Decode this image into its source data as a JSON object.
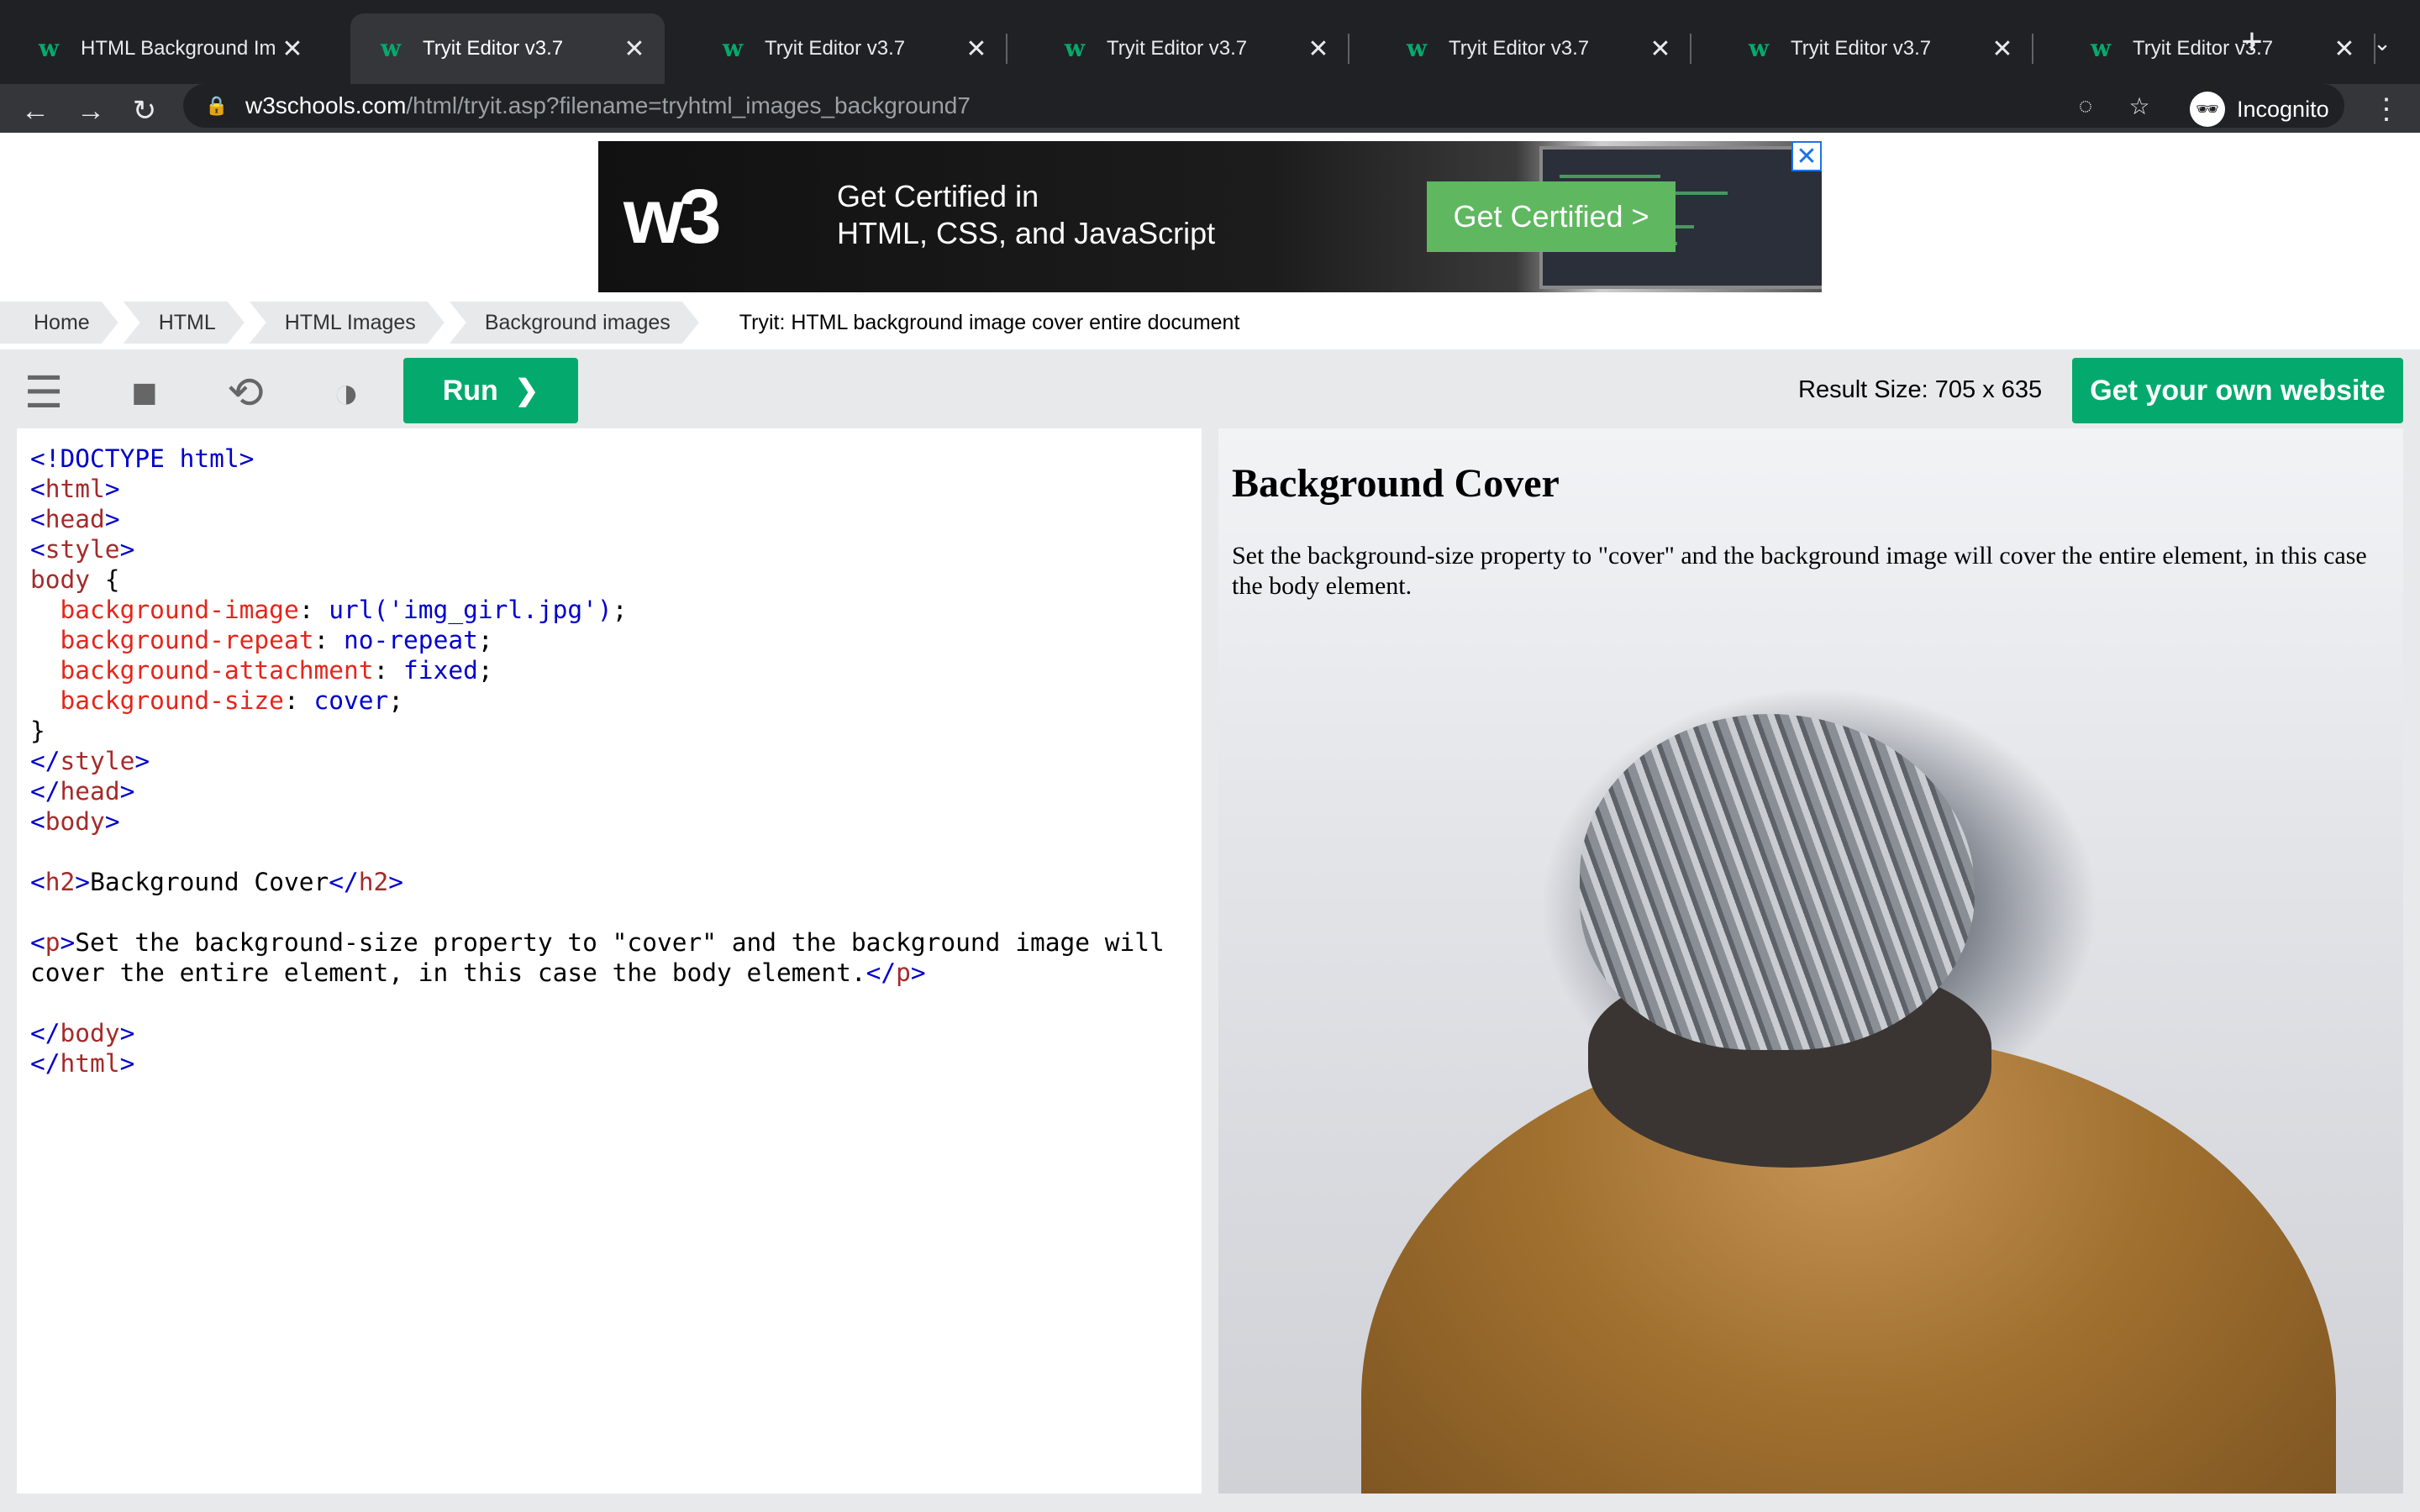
{
  "browser": {
    "tabs": [
      {
        "title": "HTML Background Im",
        "active": false
      },
      {
        "title": "Tryit Editor v3.7",
        "active": true
      },
      {
        "title": "Tryit Editor v3.7",
        "active": false
      },
      {
        "title": "Tryit Editor v3.7",
        "active": false
      },
      {
        "title": "Tryit Editor v3.7",
        "active": false
      },
      {
        "title": "Tryit Editor v3.7",
        "active": false
      },
      {
        "title": "Tryit Editor v3.7",
        "active": false
      }
    ],
    "favicon_glyph": "w",
    "close_glyph": "✕",
    "new_tab_glyph": "+",
    "tab_menu_glyph": "⌄",
    "url_domain": "w3schools.com",
    "url_path": "/html/tryit.asp?filename=tryhtml_images_background7",
    "profile_label": "Incognito",
    "icons": {
      "back": "←",
      "forward": "→",
      "reload": "↻",
      "lock": "🔒",
      "eye_off": "◌",
      "star": "☆",
      "incognito": "🕶",
      "menu": "⋮"
    }
  },
  "ad": {
    "logo": "w3",
    "line1": "Get Certified in",
    "line2": "HTML, CSS, and JavaScript",
    "button": "Get Certified >",
    "close": "✕"
  },
  "breadcrumb": [
    "Home",
    "HTML",
    "HTML Images",
    "Background images",
    "Tryit: HTML background image cover entire document"
  ],
  "toolbar": {
    "run_label": "Run",
    "run_chevron": "❯",
    "result_size": "Result Size: 705 x 635",
    "get_website_label": "Get your own website",
    "icons": {
      "menu": "☰",
      "save": "■",
      "rotate": "⟲",
      "theme": "◑"
    }
  },
  "editor": {
    "lines": [
      [
        [
          "tg",
          "<!DOCTYPE html>"
        ]
      ],
      [
        [
          "tg",
          "<"
        ],
        [
          "tn",
          "html"
        ],
        [
          "tg",
          ">"
        ]
      ],
      [
        [
          "tg",
          "<"
        ],
        [
          "tn",
          "head"
        ],
        [
          "tg",
          ">"
        ]
      ],
      [
        [
          "tg",
          "<"
        ],
        [
          "tn",
          "style"
        ],
        [
          "tg",
          ">"
        ]
      ],
      [
        [
          "tn",
          "body"
        ],
        [
          "",
          " {"
        ]
      ],
      [
        [
          "",
          "  "
        ],
        [
          "pr",
          "background-image"
        ],
        [
          "",
          ": "
        ],
        [
          "vl",
          "url('img_girl.jpg')"
        ],
        [
          "",
          ";"
        ]
      ],
      [
        [
          "",
          "  "
        ],
        [
          "pr",
          "background-repeat"
        ],
        [
          "",
          ": "
        ],
        [
          "vl",
          "no-repeat"
        ],
        [
          "",
          ";"
        ]
      ],
      [
        [
          "",
          "  "
        ],
        [
          "pr",
          "background-attachment"
        ],
        [
          "",
          ": "
        ],
        [
          "vl",
          "fixed"
        ],
        [
          "",
          ";"
        ]
      ],
      [
        [
          "",
          "  "
        ],
        [
          "pr",
          "background-size"
        ],
        [
          "",
          ": "
        ],
        [
          "vl",
          "cover"
        ],
        [
          "",
          ";"
        ]
      ],
      [
        [
          "",
          "}"
        ]
      ],
      [
        [
          "tg",
          "</"
        ],
        [
          "tn",
          "style"
        ],
        [
          "tg",
          ">"
        ]
      ],
      [
        [
          "tg",
          "</"
        ],
        [
          "tn",
          "head"
        ],
        [
          "tg",
          ">"
        ]
      ],
      [
        [
          "tg",
          "<"
        ],
        [
          "tn",
          "body"
        ],
        [
          "tg",
          ">"
        ]
      ],
      [
        [
          "",
          ""
        ]
      ],
      [
        [
          "tg",
          "<"
        ],
        [
          "tn",
          "h2"
        ],
        [
          "tg",
          ">"
        ],
        [
          "",
          "Background Cover"
        ],
        [
          "tg",
          "</"
        ],
        [
          "tn",
          "h2"
        ],
        [
          "tg",
          ">"
        ]
      ],
      [
        [
          "",
          ""
        ]
      ],
      [
        [
          "tg",
          "<"
        ],
        [
          "tn",
          "p"
        ],
        [
          "tg",
          ">"
        ],
        [
          "",
          "Set the background-size property to \"cover\" and the background image will"
        ]
      ],
      [
        [
          "",
          "cover the entire element, in this case the body element."
        ],
        [
          "tg",
          "</"
        ],
        [
          "tn",
          "p"
        ],
        [
          "tg",
          ">"
        ]
      ],
      [
        [
          "",
          ""
        ]
      ],
      [
        [
          "tg",
          "</"
        ],
        [
          "tn",
          "body"
        ],
        [
          "tg",
          ">"
        ]
      ],
      [
        [
          "tg",
          "</"
        ],
        [
          "tn",
          "html"
        ],
        [
          "tg",
          ">"
        ]
      ]
    ]
  },
  "result": {
    "heading": "Background Cover",
    "paragraph": "Set the background-size property to \"cover\" and the background image will cover the entire element, in this case the body element."
  }
}
